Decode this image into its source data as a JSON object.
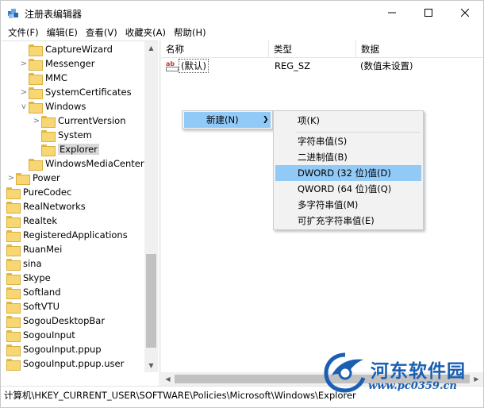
{
  "window": {
    "title": "注册表编辑器",
    "icon": "regedit-icon"
  },
  "menubar": [
    "文件(F)",
    "编辑(E)",
    "查看(V)",
    "收藏夹(A)",
    "帮助(H)"
  ],
  "tree": {
    "items": [
      {
        "label": "CaptureWizard",
        "expander": ""
      },
      {
        "label": "Messenger",
        "expander": ">"
      },
      {
        "label": "MMC",
        "expander": ""
      },
      {
        "label": "SystemCertificates",
        "expander": ">"
      },
      {
        "label": "Windows",
        "expander": "v"
      },
      {
        "label": "CurrentVersion",
        "expander": ">"
      },
      {
        "label": "System",
        "expander": ""
      },
      {
        "label": "Explorer",
        "expander": "",
        "selected": true
      },
      {
        "label": "WindowsMediaCenter",
        "expander": ""
      },
      {
        "label": "Power",
        "expander": ">"
      },
      {
        "label": "PureCodec",
        "expander": ""
      },
      {
        "label": "RealNetworks",
        "expander": ""
      },
      {
        "label": "Realtek",
        "expander": ""
      },
      {
        "label": "RegisteredApplications",
        "expander": ""
      },
      {
        "label": "RuanMei",
        "expander": ""
      },
      {
        "label": "sina",
        "expander": ""
      },
      {
        "label": "Skype",
        "expander": ""
      },
      {
        "label": "Softland",
        "expander": ""
      },
      {
        "label": "SoftVTU",
        "expander": ""
      },
      {
        "label": "SogouDesktopBar",
        "expander": ""
      },
      {
        "label": "SogouInput",
        "expander": ""
      },
      {
        "label": "SogouInput.ppup",
        "expander": ""
      },
      {
        "label": "SogouInput.ppup.user",
        "expander": ""
      }
    ]
  },
  "list": {
    "columns": [
      "名称",
      "类型",
      "数据"
    ],
    "rows": [
      {
        "icon": "ab",
        "name": "(默认)",
        "type": "REG_SZ",
        "data": "(数值未设置)"
      }
    ]
  },
  "context_menu": {
    "new_label": "新建(N)",
    "submenu": [
      "项(K)",
      "字符串值(S)",
      "二进制值(B)",
      "DWORD (32 位)值(D)",
      "QWORD (64 位)值(Q)",
      "多字符串值(M)",
      "可扩充字符串值(E)"
    ],
    "highlighted_index": 3
  },
  "statusbar": {
    "path": "计算机\\HKEY_CURRENT_USER\\SOFTWARE\\Policies\\Microsoft\\Windows\\Explorer"
  },
  "watermark": {
    "title": "河东软件园",
    "url": "www.pc0359.cn"
  },
  "colors": {
    "highlight": "#91c9f7",
    "folder": "#f7d674",
    "watermark": "#1a5fb4"
  }
}
